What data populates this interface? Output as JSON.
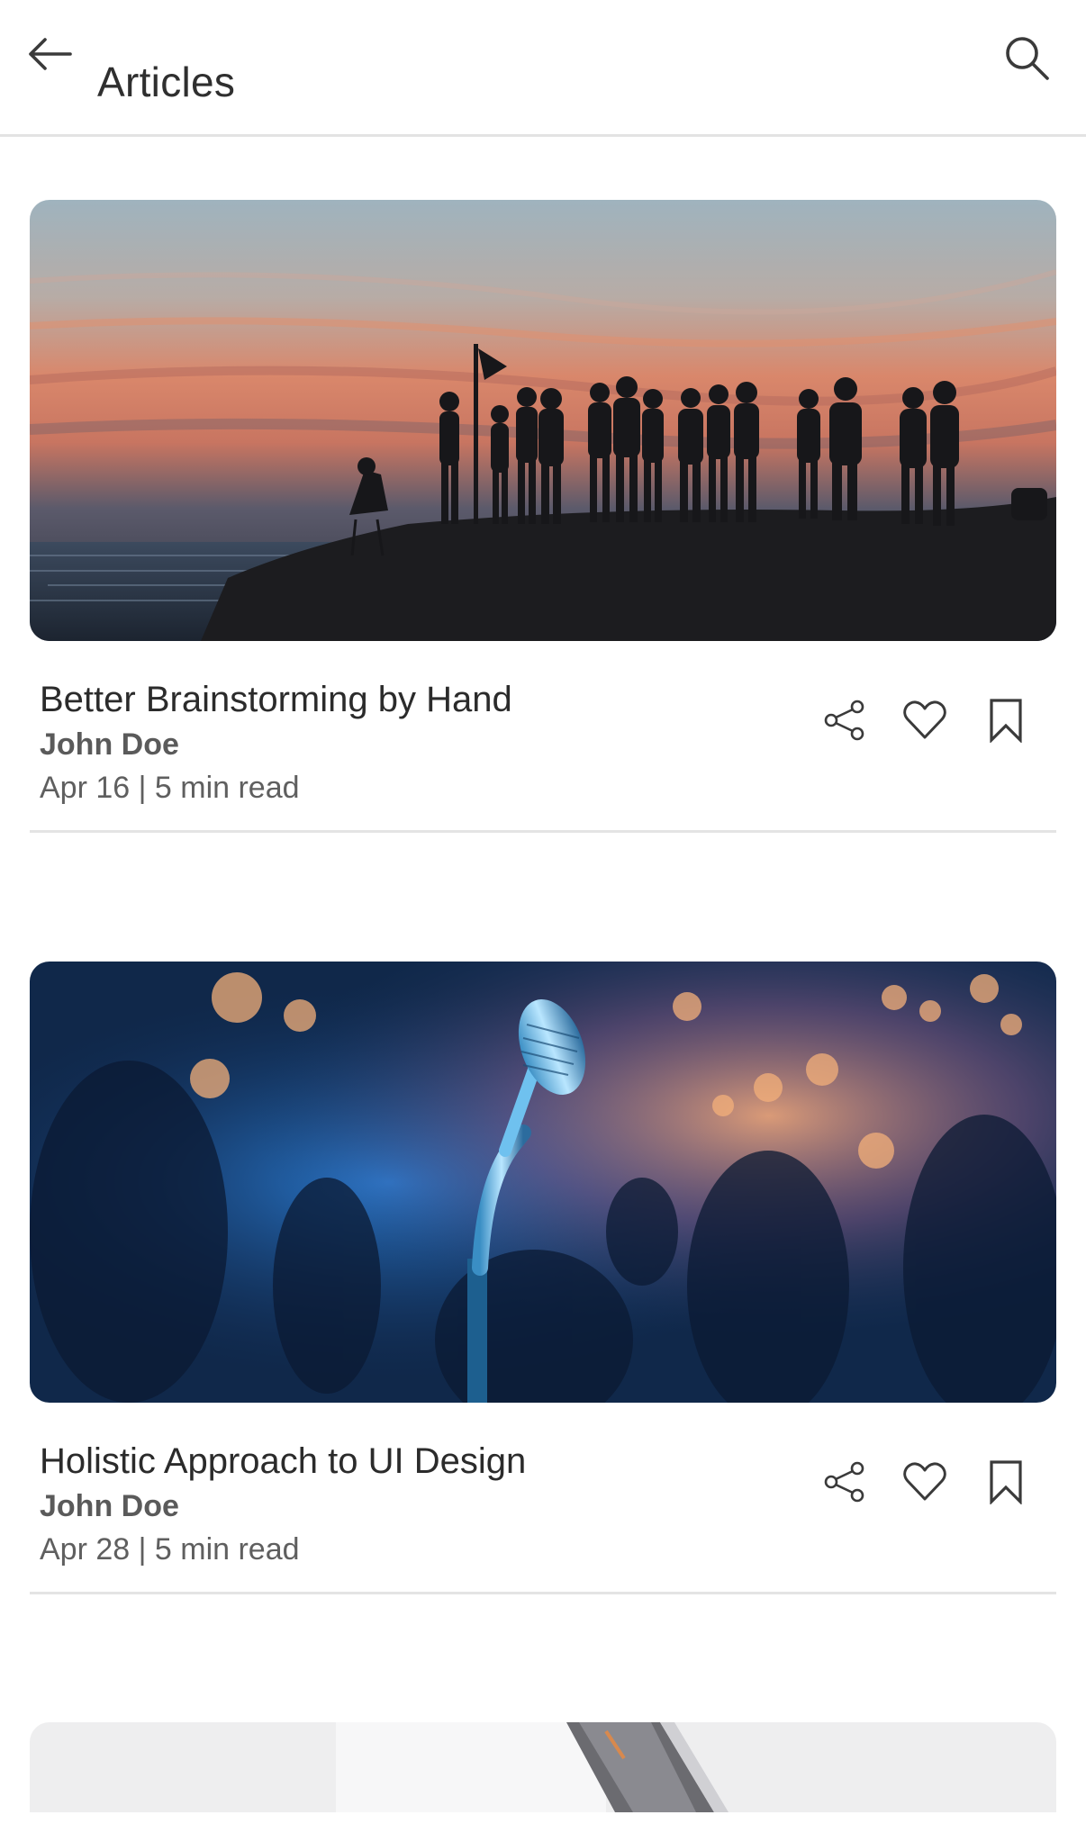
{
  "app_bar": {
    "title": "Articles",
    "back_icon": "arrow-left-icon",
    "search_icon": "search-icon"
  },
  "articles": [
    {
      "title": "Better Brainstorming by Hand",
      "author": "John Doe",
      "meta": "Apr 16 | 5 min read",
      "image": "sunset-silhouettes-image"
    },
    {
      "title": "Holistic Approach to UI Design",
      "author": "John Doe",
      "meta": "Apr 28 | 5 min read",
      "image": "microphone-concert-image"
    },
    {
      "image": "laptop-image"
    }
  ],
  "actions": {
    "share_icon": "share-icon",
    "like_icon": "heart-icon",
    "bookmark_icon": "bookmark-icon"
  },
  "colors": {
    "text_primary": "#2b2b2b",
    "text_secondary": "#5f5f5f",
    "divider": "#e4e4e4",
    "icon": "#3a3a3a"
  }
}
